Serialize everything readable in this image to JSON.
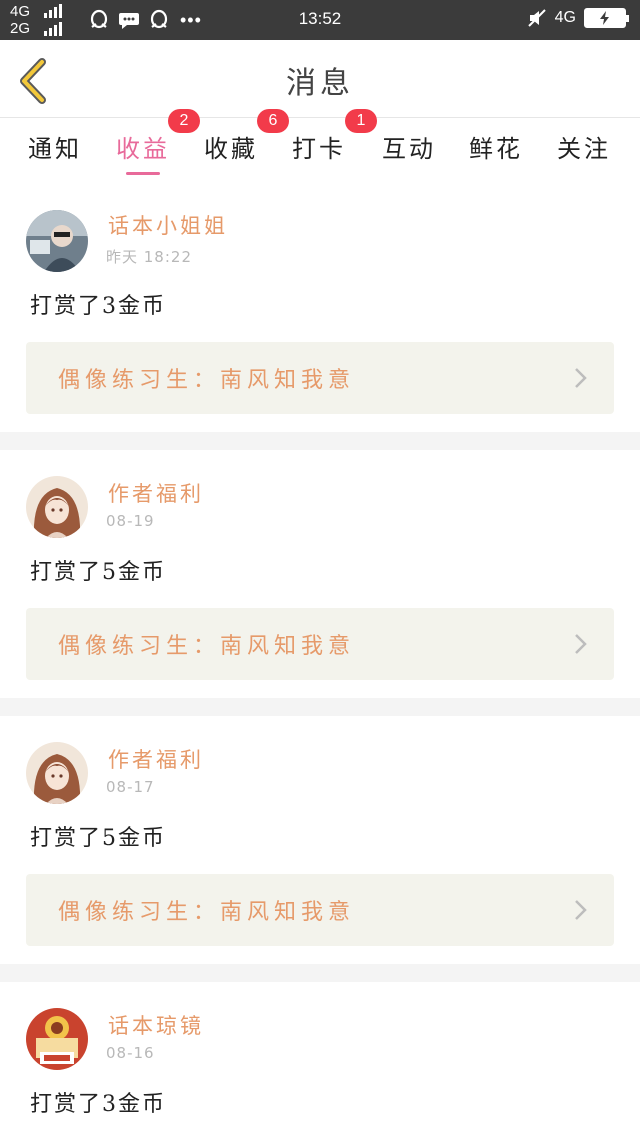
{
  "status_bar": {
    "network_1": "4G",
    "network_2": "2G",
    "time": "13:52",
    "network_right": "4G",
    "dots": "•••"
  },
  "header": {
    "title": "消息",
    "back_icon": "chevron-left-icon"
  },
  "tabs": [
    {
      "label": "通知",
      "badge": ""
    },
    {
      "label": "收益",
      "badge": "2"
    },
    {
      "label": "收藏",
      "badge": "6"
    },
    {
      "label": "打卡",
      "badge": "1"
    },
    {
      "label": "互动",
      "badge": ""
    },
    {
      "label": "鲜花",
      "badge": ""
    },
    {
      "label": "关注",
      "badge": ""
    }
  ],
  "active_tab": "收益",
  "colors": {
    "accent": "#e86a9a",
    "name": "#e69a6a",
    "badge": "#f23b4a",
    "card_box": "#f3f3ec"
  },
  "messages": [
    {
      "name": "话本小姐姐",
      "time": "昨天 18:22",
      "text": "打赏了3金币",
      "link": "偶像练习生：南风知我意"
    },
    {
      "name": "作者福利",
      "time": "08-19",
      "text": "打赏了5金币",
      "link": "偶像练习生：南风知我意"
    },
    {
      "name": "作者福利",
      "time": "08-17",
      "text": "打赏了5金币",
      "link": "偶像练习生：南风知我意"
    },
    {
      "name": "话本琼镜",
      "time": "08-16",
      "text": "打赏了3金币"
    }
  ]
}
